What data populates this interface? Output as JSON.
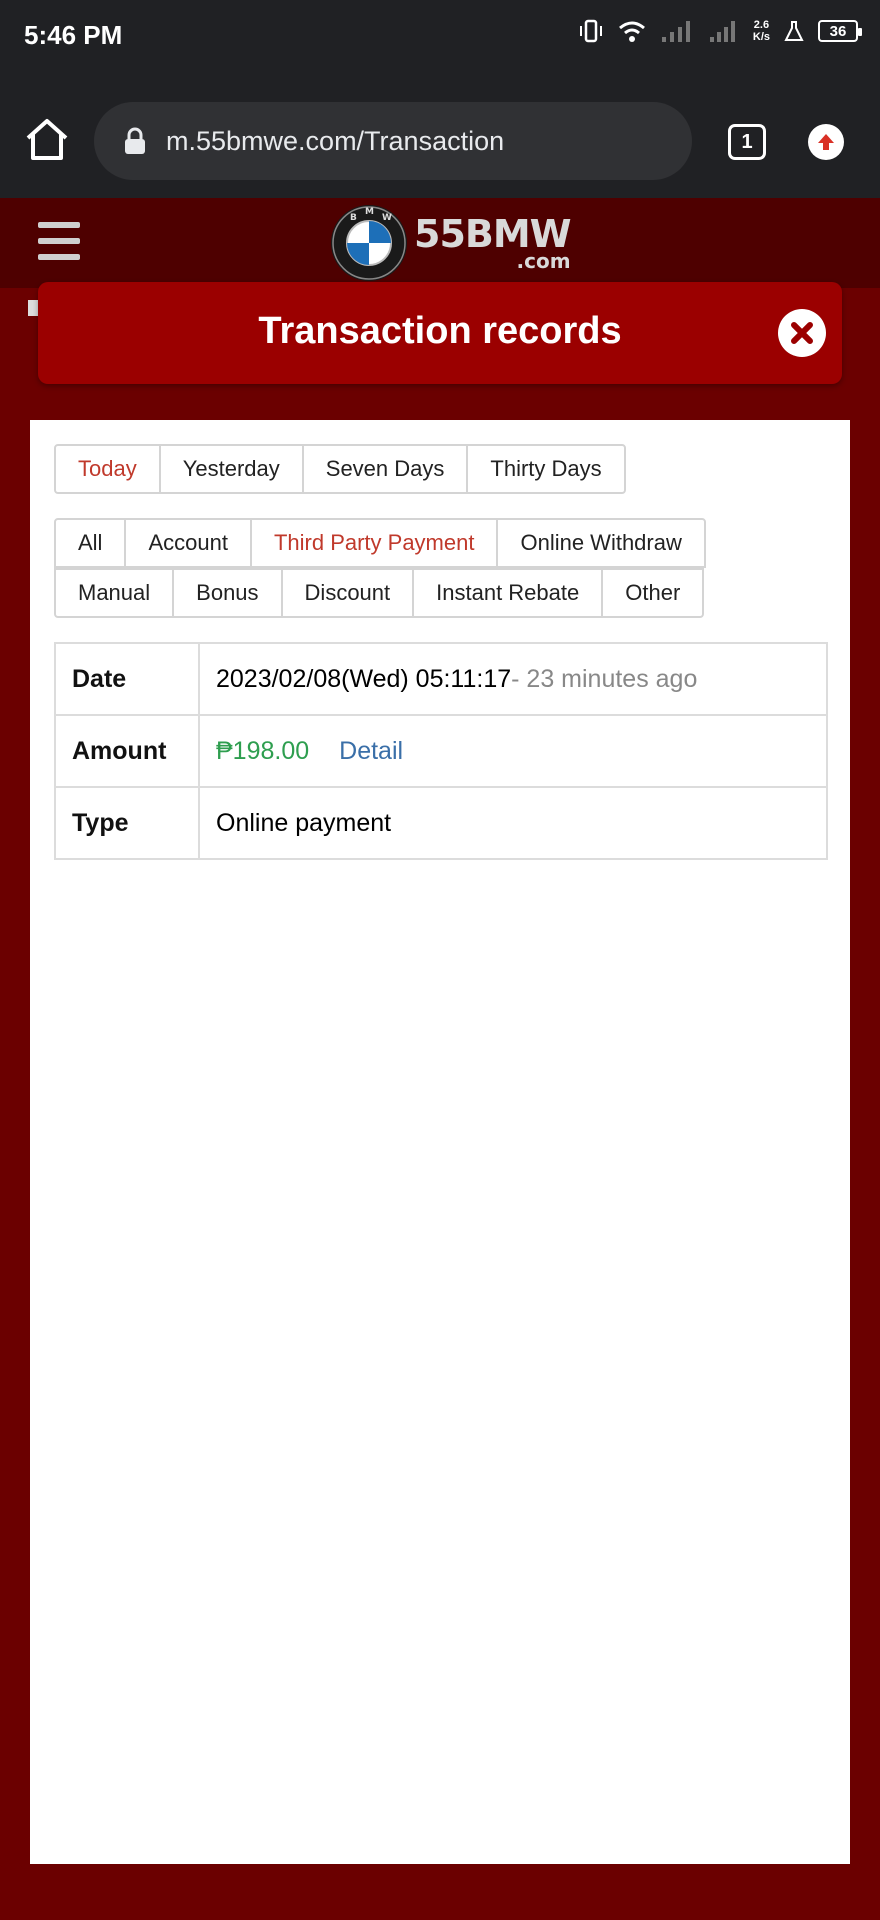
{
  "status_bar": {
    "time": "5:46 PM",
    "speed_value": "2.6",
    "speed_unit": "K/s",
    "battery": "36"
  },
  "browser": {
    "url": "m.55bmwe.com/Transaction",
    "tab_count": "1"
  },
  "site": {
    "logo_main": "55BMW",
    "logo_sub": ".com",
    "badge_letters": "BMW"
  },
  "modal": {
    "title": "Transaction records"
  },
  "filters": {
    "period": [
      "Today",
      "Yesterday",
      "Seven Days",
      "Thirty Days"
    ],
    "period_active": "Today",
    "type_row1": [
      "All",
      "Account",
      "Third Party Payment",
      "Online Withdraw"
    ],
    "type_row2": [
      "Manual",
      "Bonus",
      "Discount",
      "Instant Rebate",
      "Other"
    ],
    "type_active": "Third Party Payment"
  },
  "record": {
    "date_label": "Date",
    "date_value": "2023/02/08(Wed) 05:11:17",
    "date_ago": "- 23 minutes ago",
    "amount_label": "Amount",
    "amount_value": "₱198.00",
    "detail_link": "Detail",
    "type_label": "Type",
    "type_value": "Online payment"
  },
  "colors": {
    "page_bg": "#6b0000",
    "header_bg": "#4e0000",
    "modal_header": "#9b0000",
    "active_tab": "#c0392b",
    "amount": "#2e9e4f",
    "link": "#3a6fa8"
  }
}
